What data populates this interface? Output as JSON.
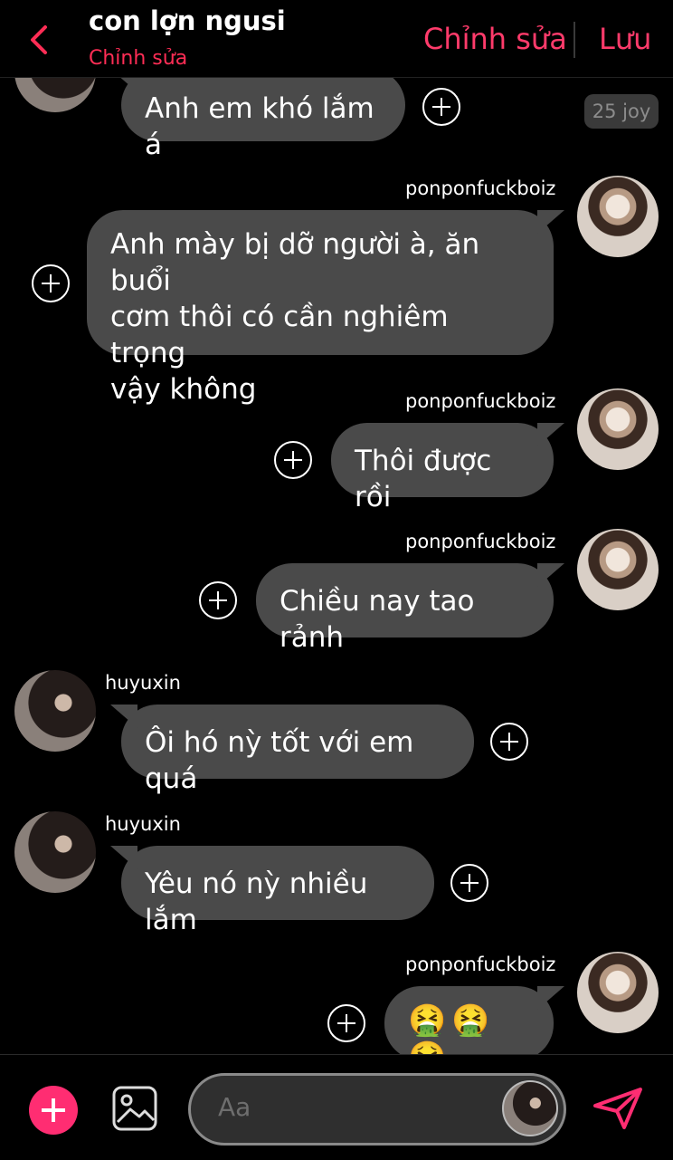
{
  "header": {
    "title": "con lợn ngusi",
    "subtitle": "Chỉnh sửa",
    "edit_label": "Chỉnh sửa",
    "save_label": "Lưu"
  },
  "messages": [
    {
      "sender": "",
      "side": "left",
      "text": "Anh em khó lắm á",
      "badge": "25 joy"
    },
    {
      "sender": "ponponfuckboiz",
      "side": "right",
      "lines": [
        "Anh mày bị dỡ người à, ăn buổi",
        "cơm thôi có cần nghiêm trọng",
        "vậy không"
      ]
    },
    {
      "sender": "ponponfuckboiz",
      "side": "right",
      "text": "Thôi được rồi"
    },
    {
      "sender": "ponponfuckboiz",
      "side": "right",
      "text": "Chiều nay tao rảnh"
    },
    {
      "sender": "huyuxin",
      "side": "left",
      "text": "Ôi hó nỳ tốt với em quá"
    },
    {
      "sender": "huyuxin",
      "side": "left",
      "text": "Yêu nó nỳ nhiều lắm"
    },
    {
      "sender": "ponponfuckboiz",
      "side": "right",
      "text": "🤮🤮🤮"
    }
  ],
  "composer": {
    "placeholder": "Aa"
  },
  "colors": {
    "accent": "#ff2d72",
    "bubble": "#4a4a4a",
    "background": "#000000"
  }
}
